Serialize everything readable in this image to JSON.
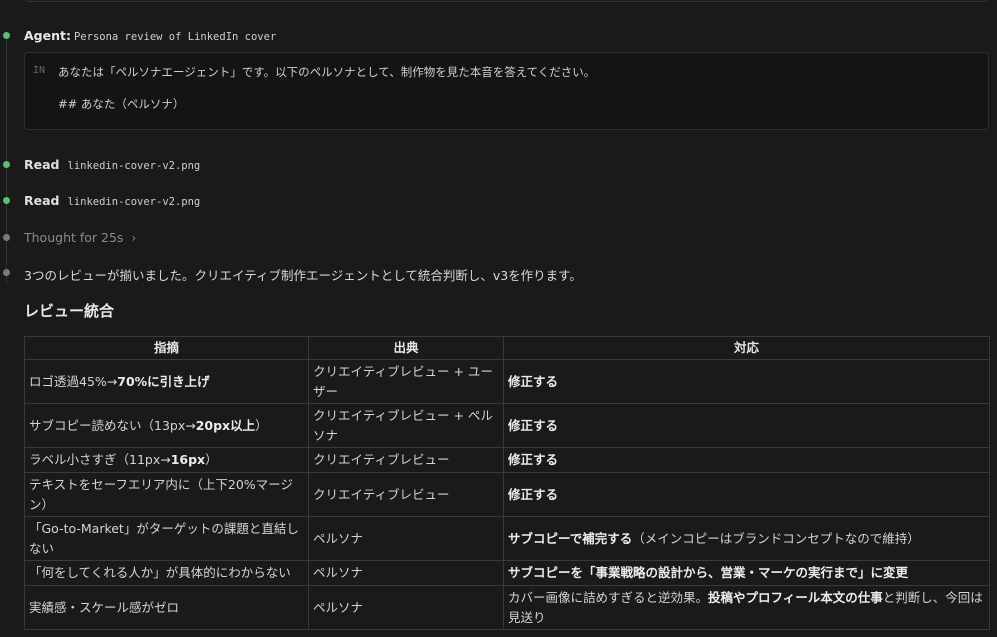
{
  "agent": {
    "label": "Agent:",
    "task": "Persona review of LinkedIn cover"
  },
  "prompt": {
    "tag": "IN",
    "line1": "あなたは「ペルソナエージェント」です。以下のペルソナとして、制作物を見た本音を答えてください。",
    "line2": "## あなた（ペルソナ）"
  },
  "reads": [
    {
      "label": "Read",
      "file": "linkedin-cover-v2.png"
    },
    {
      "label": "Read",
      "file": "linkedin-cover-v2.png"
    }
  ],
  "thought": {
    "text": "Thought for 25s"
  },
  "summary": "3つのレビューが揃いました。クリエイティブ制作エージェントとして統合判断し、v3を作ります。",
  "heading": "レビュー統合",
  "table": {
    "headers": [
      "指摘",
      "出典",
      "対応"
    ],
    "rows": [
      {
        "c1a": "ロゴ透過45%→",
        "c1b": "70%に引き上げ",
        "c1c": "",
        "c2": "クリエイティブレビュー + ユーザー",
        "c3a": "修正する",
        "c3b": "",
        "c3c": "",
        "c3d": "",
        "c3e": ""
      },
      {
        "c1a": "サブコピー読めない（13px→",
        "c1b": "20px以上",
        "c1c": "）",
        "c2": "クリエイティブレビュー + ペルソナ",
        "c3a": "修正する",
        "c3b": "",
        "c3c": "",
        "c3d": "",
        "c3e": ""
      },
      {
        "c1a": "ラベル小さすぎ（11px→",
        "c1b": "16px",
        "c1c": "）",
        "c2": "クリエイティブレビュー",
        "c3a": "修正する",
        "c3b": "",
        "c3c": "",
        "c3d": "",
        "c3e": ""
      },
      {
        "c1a": "テキストをセーフエリア内に（上下20%マージン）",
        "c1b": "",
        "c1c": "",
        "c2": "クリエイティブレビュー",
        "c3a": "修正する",
        "c3b": "",
        "c3c": "",
        "c3d": "",
        "c3e": ""
      },
      {
        "c1a": "「Go-to-Market」がターゲットの課題と直結しない",
        "c1b": "",
        "c1c": "",
        "c2": "ペルソナ",
        "c3a": "サブコピーで補完する",
        "c3b": "（メインコピーはブランドコンセプトなので維持）",
        "c3c": "",
        "c3d": "",
        "c3e": ""
      },
      {
        "c1a": "「何をしてくれる人か」が具体的にわからない",
        "c1b": "",
        "c1c": "",
        "c2": "ペルソナ",
        "c3a": "サブコピーを「事業戦略の設計から、営業・マーケの実行まで」に変更",
        "c3b": "",
        "c3c": "",
        "c3d": "",
        "c3e": ""
      },
      {
        "c1a": "実績感・スケール感がゼロ",
        "c1b": "",
        "c1c": "",
        "c2": "ペルソナ",
        "c3a": "",
        "c3b": "カバー画像に詰めすぎると逆効果。",
        "c3c": "投稿やプロフィール本文の仕事",
        "c3d": "と判断し、今回は見送り",
        "c3e": ""
      }
    ]
  }
}
